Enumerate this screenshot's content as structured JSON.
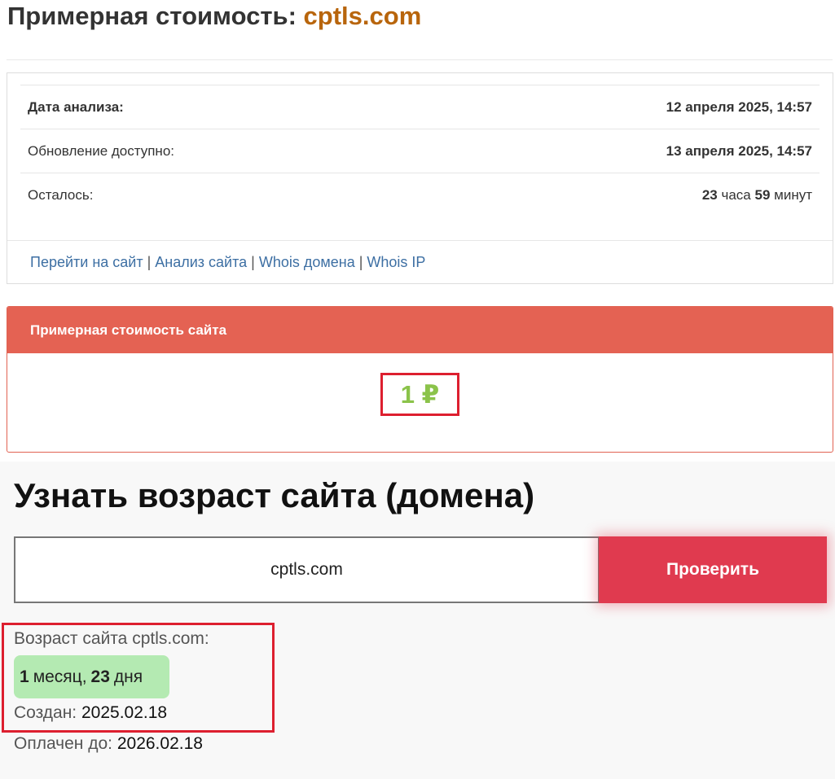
{
  "header": {
    "title_prefix": "Примерная стоимость:",
    "domain": "cptls.com"
  },
  "info": {
    "rows": [
      {
        "label": "Дата анализа:",
        "value": "12 апреля 2025, 14:57"
      },
      {
        "label": "Обновление доступно:",
        "value": "13 апреля 2025, 14:57"
      }
    ],
    "remaining": {
      "label": "Осталось:",
      "hours": "23",
      "hours_unit": "часа",
      "minutes": "59",
      "minutes_unit": "минут"
    },
    "links": [
      "Перейти на сайт",
      "Анализ сайта",
      "Whois домена",
      "Whois IP"
    ],
    "link_separator": "|"
  },
  "cost": {
    "heading": "Примерная стоимость сайта",
    "value": "1 ₽"
  },
  "age": {
    "title": "Узнать возраст сайта (домена)",
    "input_value": "cptls.com",
    "button_label": "Проверить",
    "result_label": "Возраст сайта cptls.com:",
    "months": "1",
    "months_unit": "месяц,",
    "days": "23",
    "days_unit": "дня",
    "created_label": "Создан:",
    "created_value": "2025.02.18",
    "paid_label": "Оплачен до:",
    "paid_value": "2026.02.18"
  },
  "colors": {
    "domain": "#b8650c",
    "panel_header": "#e46253",
    "price": "#8bc34a",
    "highlight_box": "#dd1f2f",
    "button": "#e03a4f",
    "badge": "#b4eab2",
    "link": "#3d6fa3"
  }
}
